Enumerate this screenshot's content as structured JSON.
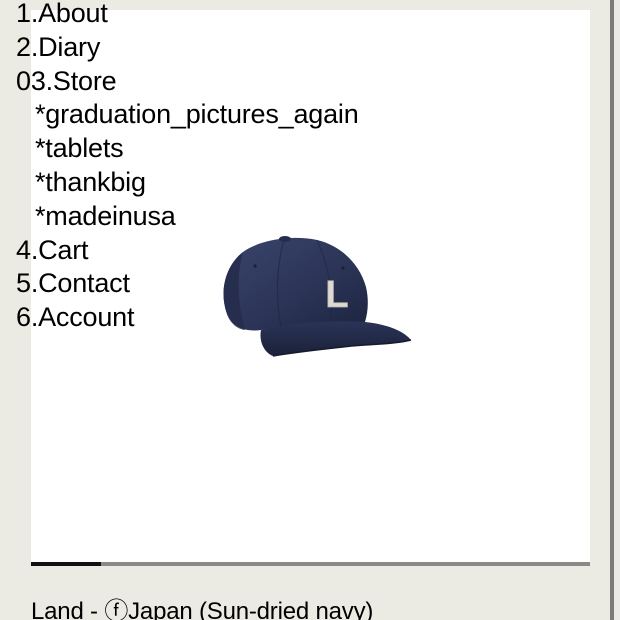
{
  "nav": {
    "items": [
      {
        "label": "1.About"
      },
      {
        "label": "2.Diary"
      },
      {
        "label": "03.Store"
      },
      {
        "label": "*graduation_pictures_again"
      },
      {
        "label": "*tablets"
      },
      {
        "label": "*thankbig"
      },
      {
        "label": "*madeinusa"
      },
      {
        "label": "4.Cart"
      },
      {
        "label": "5.Contact"
      },
      {
        "label": "6.Account"
      }
    ]
  },
  "product": {
    "image_icon": "navy-baseball-cap-with-L-letter",
    "cap_letter": "L",
    "caption": "Land - ⓕJapan (Sun-dried navy)"
  },
  "slideshow": {
    "progress": 0.125
  },
  "colors": {
    "page_background": "#ecebe3",
    "panel_background": "#ffffff",
    "cap_navy": "#2c3558",
    "track": "#8a8a86",
    "progress": "#111111"
  }
}
